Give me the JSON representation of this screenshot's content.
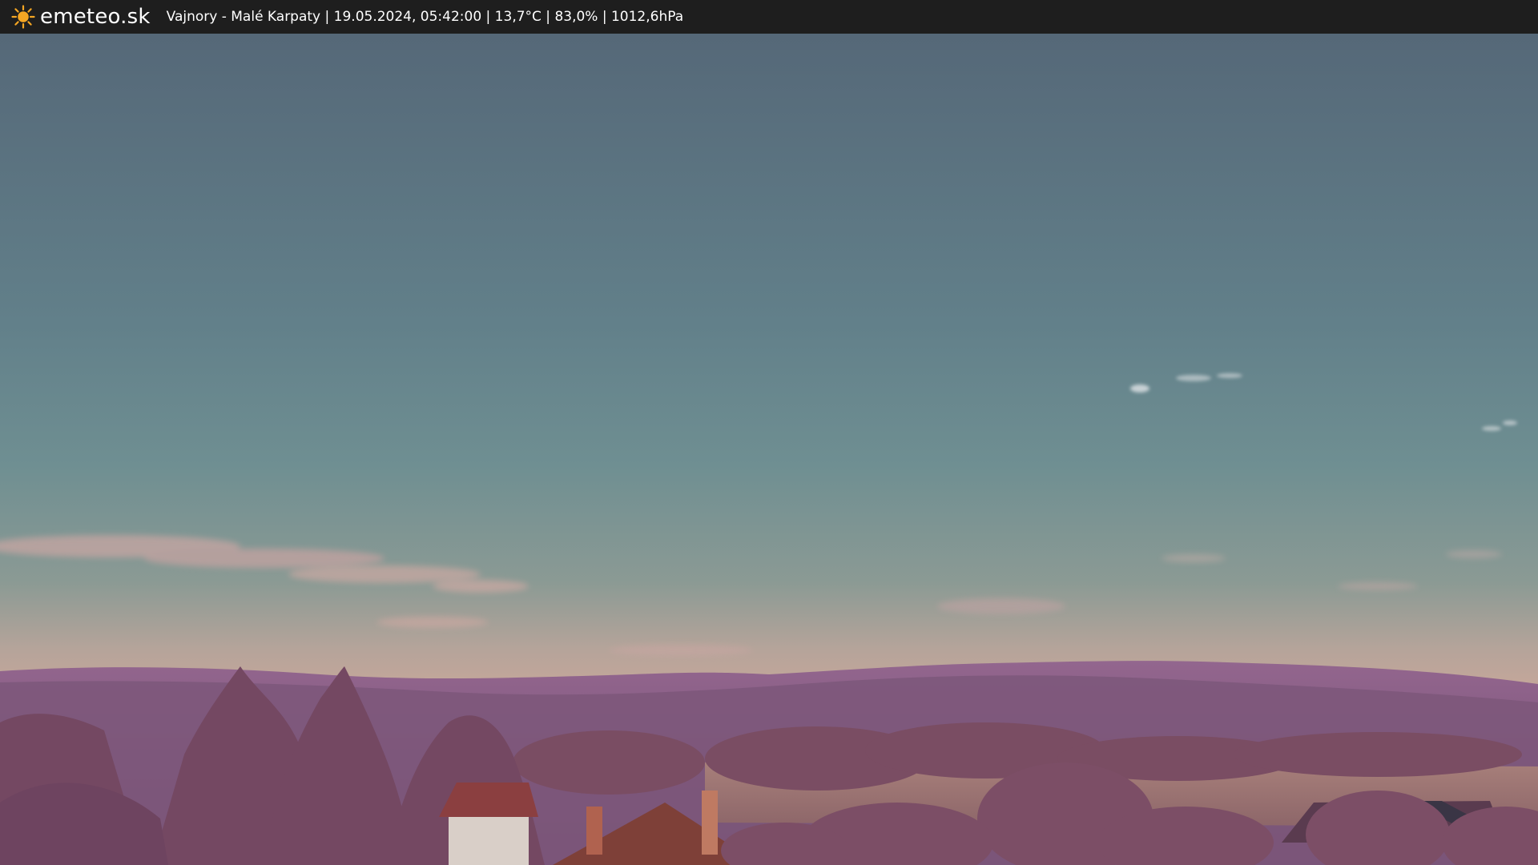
{
  "header": {
    "logo_text": "emeteo.sk",
    "logo_icon": "sun-icon",
    "caption": "Vajnory - Malé Karpaty | 19.05.2024, 05:42:00 | 13,7°C | 83,0% | 1012,6hPa"
  },
  "colors": {
    "bar_background": "#1e1e1e",
    "sun": "#f5a623",
    "sky_top": "#55697a",
    "sky_horizon": "#c9a79a",
    "hills": "#8a5f86",
    "trees": "#7d4f66"
  }
}
